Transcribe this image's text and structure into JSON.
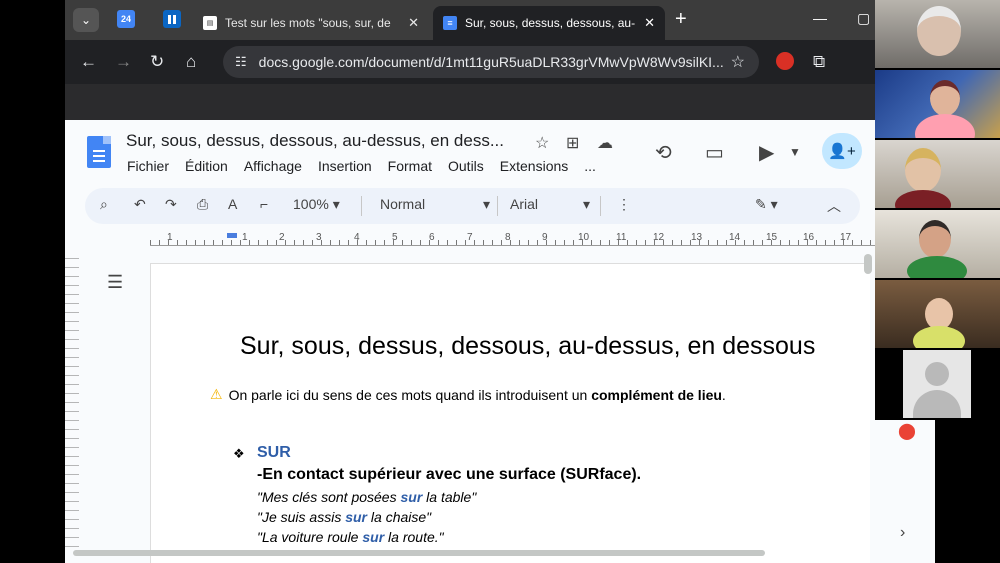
{
  "browser": {
    "tabs": [
      {
        "title": "Test sur les mots \"sous, sur, de",
        "active": false
      },
      {
        "title": "Sur, sous, dessus, dessous, au-",
        "active": true
      }
    ],
    "pinned": [
      {
        "label": "24",
        "color": "#4285f4"
      },
      {
        "label": "",
        "color": "#0b66c3"
      }
    ],
    "url": "docs.google.com/document/d/1mt11guR5uaDLR33grVMwVpW8Wv9silKI...",
    "new_tab_label": "+"
  },
  "docs": {
    "title": "Sur, sous, dessus, dessous, au-dessus, en dess...",
    "menus": [
      "Fichier",
      "Édition",
      "Affichage",
      "Insertion",
      "Format",
      "Outils",
      "Extensions",
      "..."
    ],
    "zoom": "100%",
    "style": "Normal",
    "font": "Arial",
    "ruler_numbers": [
      "1",
      "1",
      "2",
      "3",
      "4",
      "5",
      "6",
      "7",
      "8",
      "9",
      "10",
      "11",
      "12",
      "13",
      "14",
      "15",
      "16",
      "17"
    ]
  },
  "document": {
    "heading": "Sur, sous, dessus, dessous, au-dessus, en dessous",
    "note_prefix": "On parle ici du sens de ces mots quand ils introduisent un ",
    "note_bold": "complément de lieu",
    "note_suffix": ".",
    "section_title": "SUR",
    "section_subtitle": "-En contact supérieur avec une surface (SURface).",
    "examples": [
      {
        "pre": "\"Mes clés sont posées ",
        "kw": "sur",
        "post": " la table\""
      },
      {
        "pre": "\"Je suis assis ",
        "kw": "sur",
        "post": " la chaise\""
      },
      {
        "pre": "\"La voiture roule ",
        "kw": "sur",
        "post": " la route.\""
      }
    ]
  },
  "colors": {
    "accent": "#2f5ea8",
    "share": "#c2e7ff",
    "docs_blue": "#4285f4"
  }
}
